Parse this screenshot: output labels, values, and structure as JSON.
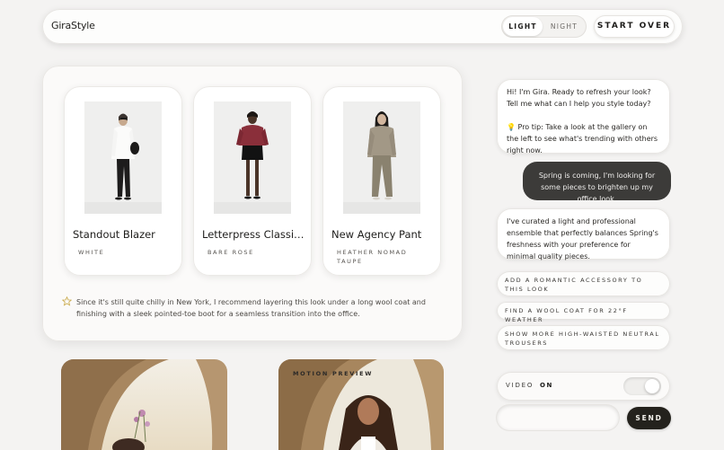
{
  "header": {
    "brand": "GiraStyle",
    "theme_options": [
      "LIGHT",
      "NIGHT"
    ],
    "theme_selected": "LIGHT",
    "start_over_label": "START OVER"
  },
  "gallery": {
    "items": [
      {
        "name": "Standout Blazer",
        "color": "WHITE"
      },
      {
        "name": "Letterpress Classic Po...",
        "color": "BARE ROSE"
      },
      {
        "name": "New Agency Pant",
        "color": "HEATHER NOMAD TAUPE"
      }
    ],
    "tip_icon": "star-icon",
    "tip": "Since it's still quite chilly in New York, I recommend layering this look under a long wool coat and finishing with a sleek pointed-toe boot for a seamless transition into the office."
  },
  "media": {
    "motion_label": "MOTION PREVIEW"
  },
  "chat": {
    "messages": [
      {
        "role": "assistant",
        "paragraphs": [
          "Hi! I'm Gira. Ready to refresh your look? Tell me what can I help you style today?",
          "💡 Pro tip: Take a look at the gallery on the left to see what's trending with others right now."
        ]
      },
      {
        "role": "user",
        "paragraphs": [
          "Spring is coming, I'm looking for some pieces to brighten up my office look."
        ]
      },
      {
        "role": "assistant",
        "paragraphs": [
          "I've curated a light and professional ensemble that perfectly balances Spring's freshness with your preference for minimal quality pieces."
        ]
      }
    ],
    "suggestions": [
      "ADD A ROMANTIC ACCESSORY TO THIS LOOK",
      "FIND A WOOL COAT FOR 22°F WEATHER",
      "SHOW MORE HIGH-WAISTED NEUTRAL TROUSERS"
    ],
    "video_label": "VIDEO",
    "video_state": "ON",
    "input_value": "",
    "input_placeholder": "",
    "send_label": "SEND"
  },
  "colors": {
    "background": "#f4f3f2",
    "accent_dark": "#24221d",
    "user_bubble": "#3c3b39"
  }
}
